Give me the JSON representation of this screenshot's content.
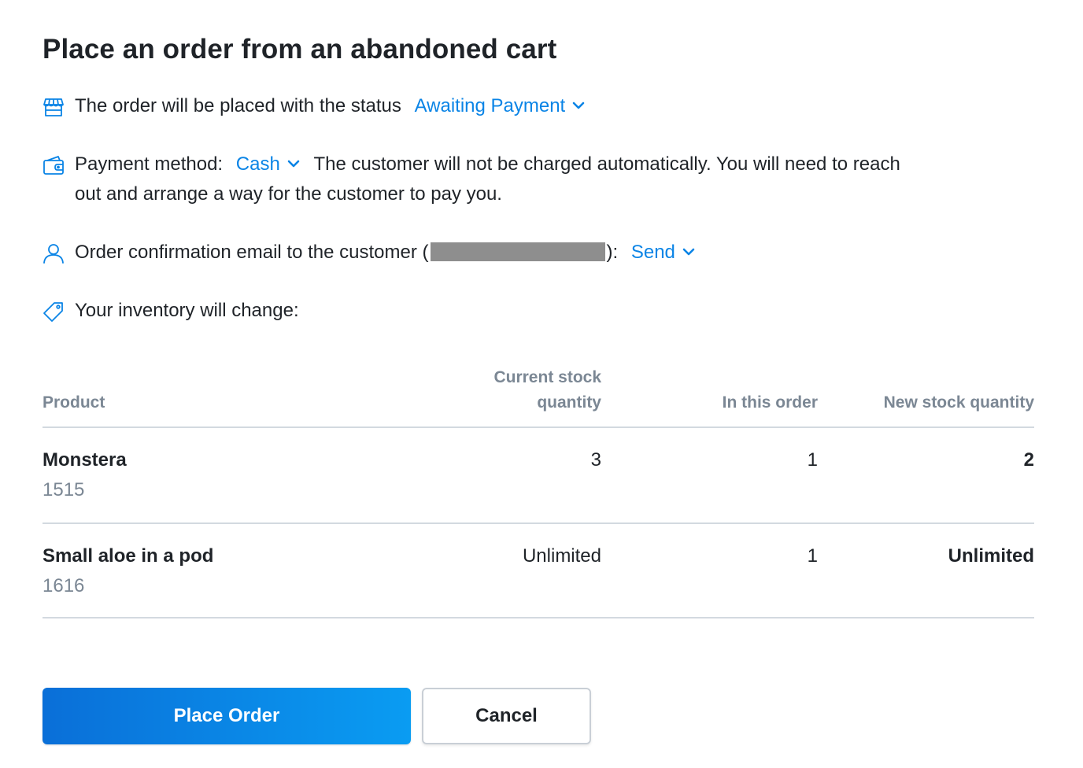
{
  "dialog": {
    "title": "Place an order from an abandoned cart"
  },
  "status_row": {
    "icon": "storefront-icon",
    "text": "The order will be placed with the status",
    "value": "Awaiting Payment"
  },
  "payment_row": {
    "icon": "wallet-icon",
    "label": "Payment method:",
    "value": "Cash",
    "note_line1": "The customer will not be charged automatically. You will need to reach",
    "note_line2": "out and arrange a way for the customer to pay you."
  },
  "email_row": {
    "icon": "user-icon",
    "text_before": "Order confirmation email to the customer (",
    "text_after": "):",
    "value": "Send"
  },
  "inventory_row": {
    "icon": "tag-icon",
    "text": "Your inventory will change:"
  },
  "table": {
    "headers": {
      "product": "Product",
      "current_line1": "Current stock",
      "current_line2": "quantity",
      "in_order": "In this order",
      "new_stock": "New stock quantity"
    },
    "rows": [
      {
        "name": "Monstera",
        "sku": "1515",
        "current": "3",
        "in_order": "1",
        "new_stock": "2"
      },
      {
        "name": "Small aloe in a pod",
        "sku": "1616",
        "current": "Unlimited",
        "in_order": "1",
        "new_stock": "Unlimited"
      }
    ]
  },
  "buttons": {
    "place_order": "Place Order",
    "cancel": "Cancel"
  },
  "colors": {
    "accent": "#0a84e6",
    "primary_button_start": "#0a6fd8",
    "primary_button_end": "#0a9cf2",
    "muted_text": "#7b8794",
    "divider": "#d3d9e0"
  }
}
